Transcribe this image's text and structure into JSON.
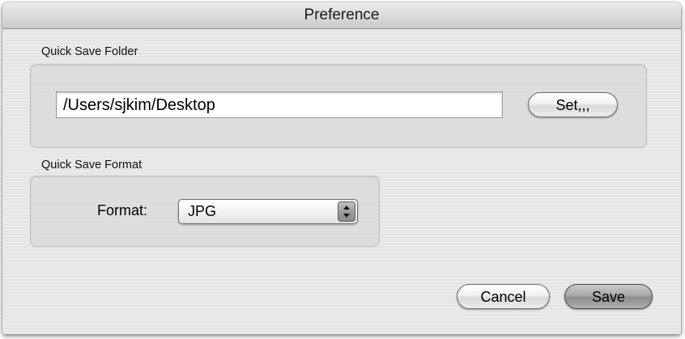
{
  "window": {
    "title": "Preference"
  },
  "quick_save_folder": {
    "section_label": "Quick Save Folder",
    "path_value": "/Users/sjkim/Desktop",
    "set_button_label": "Set,,,"
  },
  "quick_save_format": {
    "section_label": "Quick Save Format",
    "format_label": "Format:",
    "format_value": "JPG",
    "popup_arrows_icon": "updown-arrows-icon"
  },
  "footer": {
    "cancel_label": "Cancel",
    "save_label": "Save"
  },
  "colors": {
    "window_bg": "#e8e8e8",
    "default_button": "#9a9a9a"
  }
}
